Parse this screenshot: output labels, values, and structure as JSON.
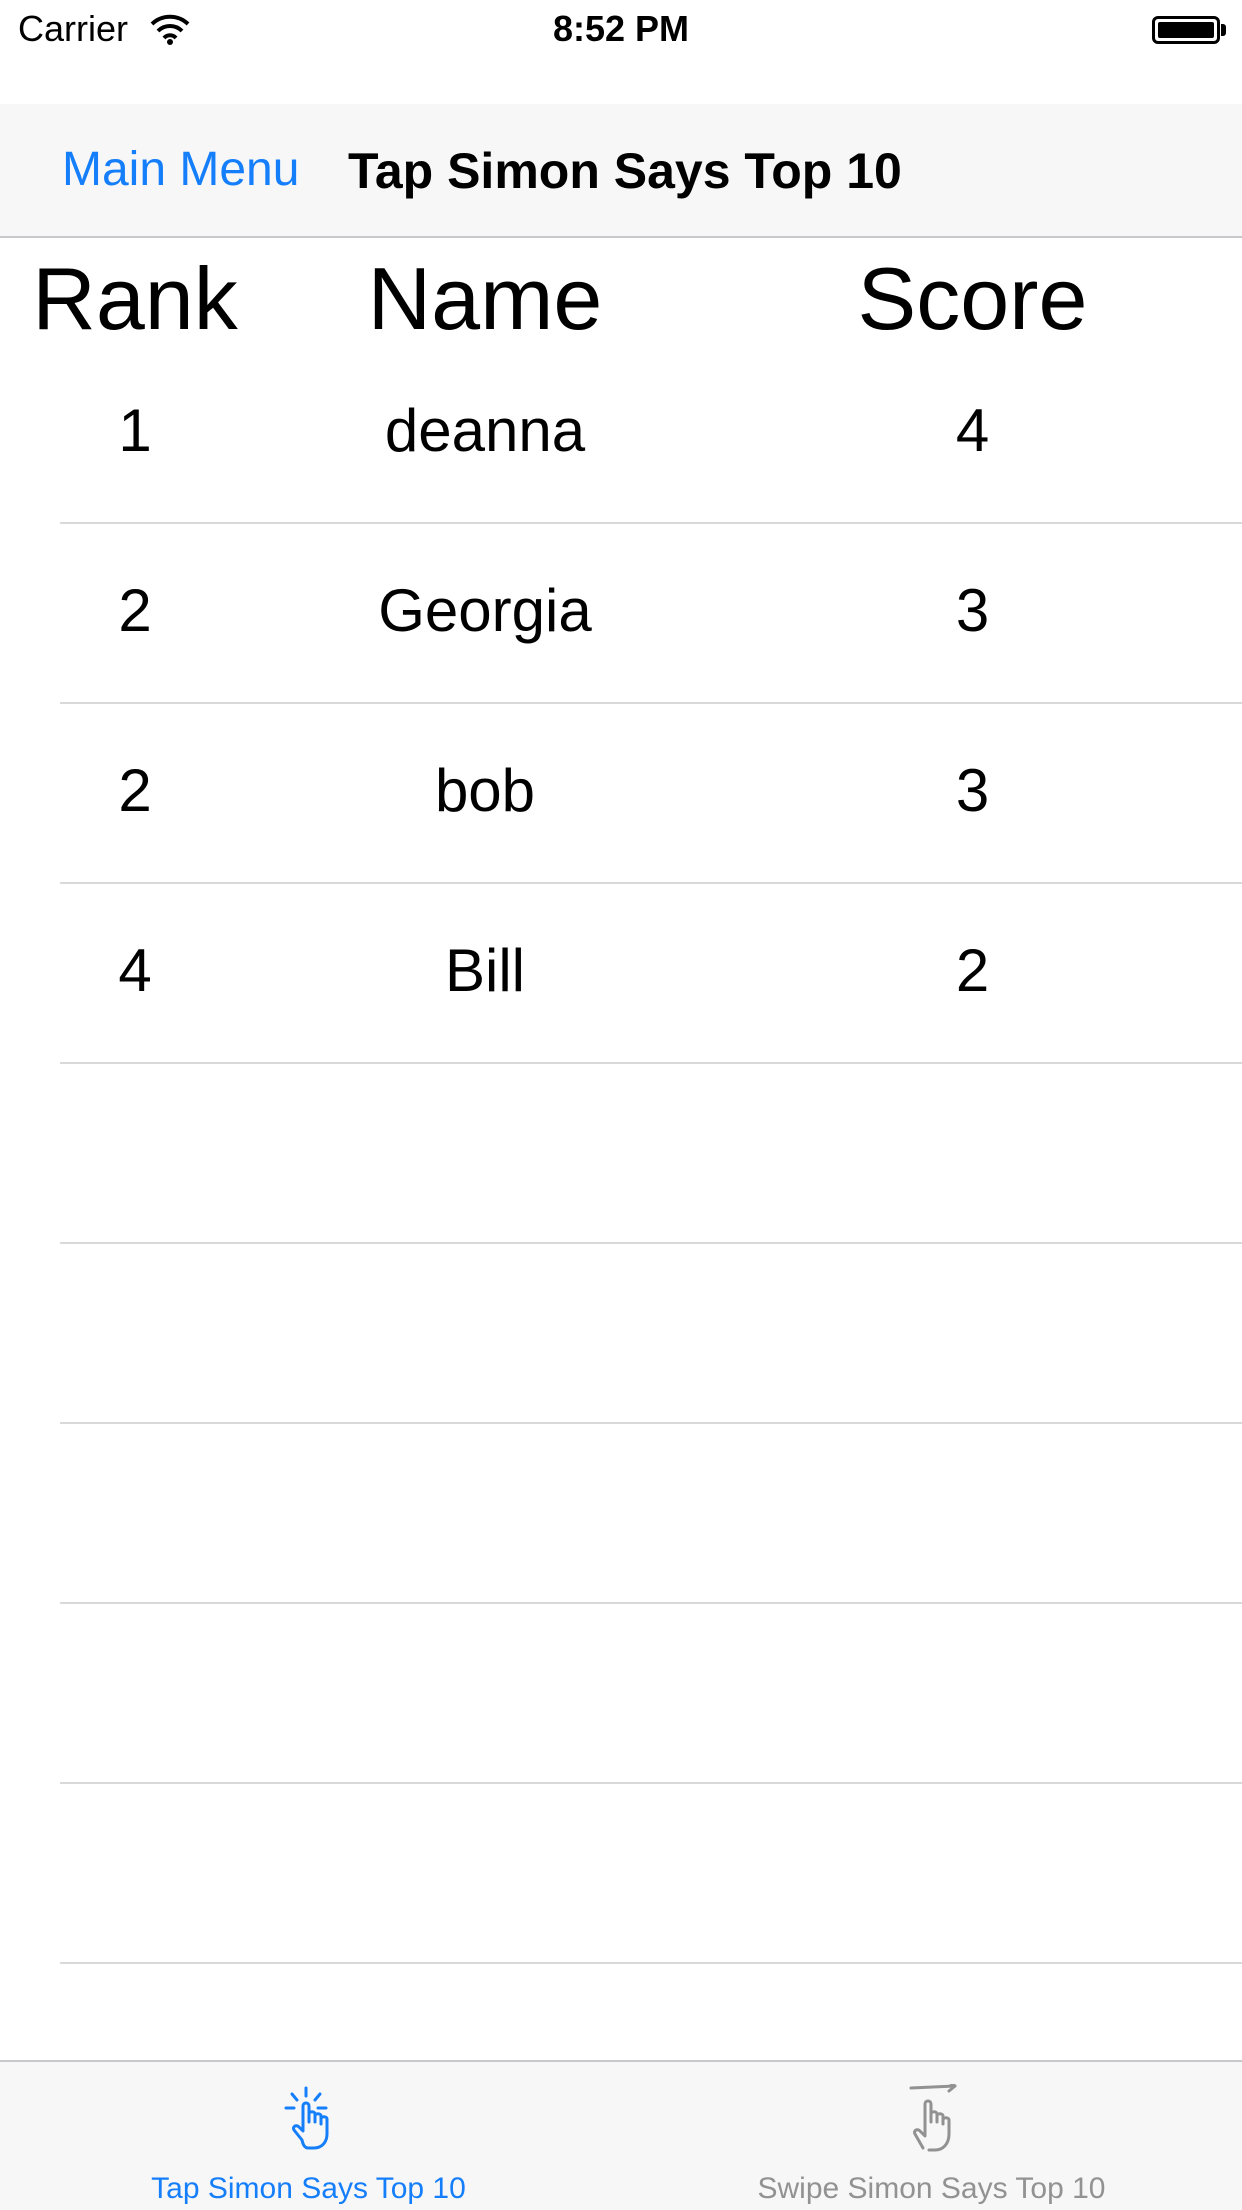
{
  "status_bar": {
    "carrier": "Carrier",
    "time": "8:52 PM"
  },
  "nav": {
    "back_label": "Main Menu",
    "title": "Tap Simon Says Top 10"
  },
  "table": {
    "headers": {
      "rank": "Rank",
      "name": "Name",
      "score": "Score"
    },
    "rows": [
      {
        "rank": "1",
        "name": "deanna",
        "score": "4"
      },
      {
        "rank": "2",
        "name": "Georgia",
        "score": "3"
      },
      {
        "rank": "2",
        "name": "bob",
        "score": "3"
      },
      {
        "rank": "4",
        "name": "Bill",
        "score": "2"
      },
      {
        "rank": "",
        "name": "",
        "score": ""
      },
      {
        "rank": "",
        "name": "",
        "score": ""
      },
      {
        "rank": "",
        "name": "",
        "score": ""
      },
      {
        "rank": "",
        "name": "",
        "score": ""
      },
      {
        "rank": "",
        "name": "",
        "score": ""
      }
    ]
  },
  "tab_bar": {
    "tabs": [
      {
        "label": "Tap Simon Says Top 10",
        "icon": "tap-hand-icon",
        "selected": true
      },
      {
        "label": "Swipe Simon Says Top 10",
        "icon": "swipe-hand-icon",
        "selected": false
      }
    ]
  },
  "colors": {
    "accent": "#157efb",
    "inactive_tab": "#929292",
    "bar_background": "#f7f7f7",
    "separator": "#d9d9d9"
  }
}
